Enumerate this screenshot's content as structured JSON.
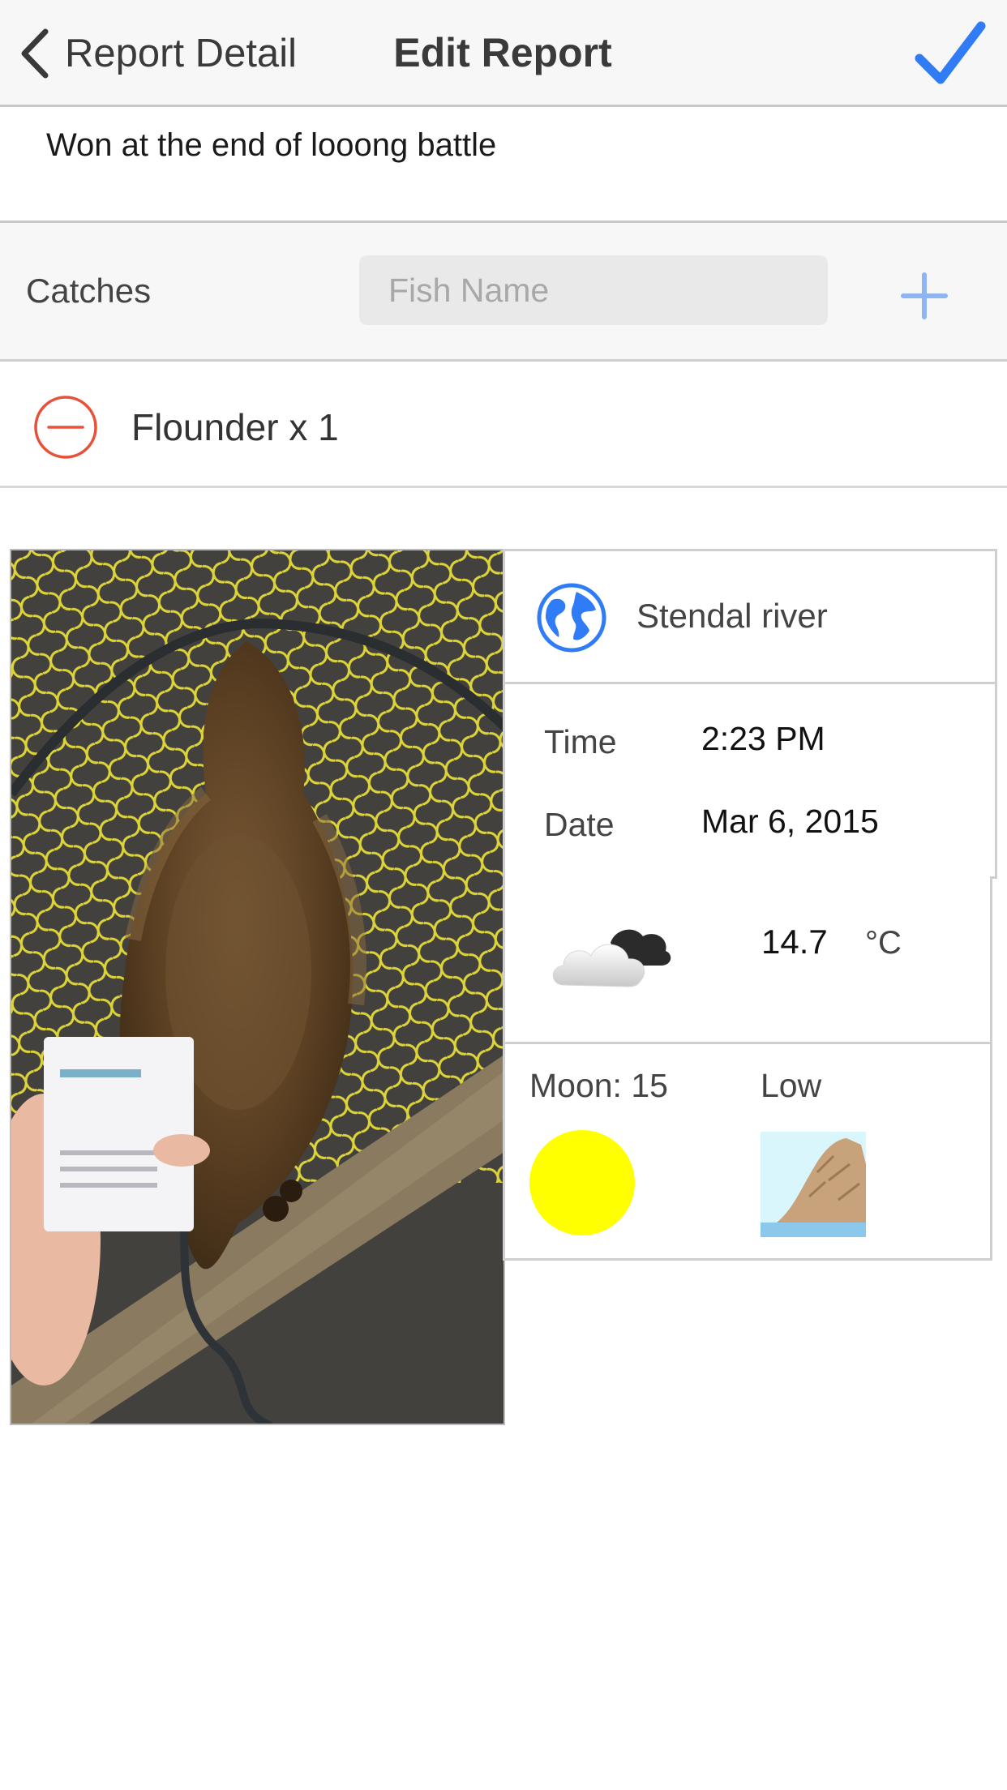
{
  "nav": {
    "back_label": "Report Detail",
    "title": "Edit Report",
    "accent": "#2f7cf6"
  },
  "description": {
    "text": "Won at the end of looong battle"
  },
  "catches": {
    "label": "Catches",
    "input_placeholder": "Fish Name",
    "input_value": "",
    "add_icon": "plus-icon",
    "items": [
      {
        "label": "Flounder x 1",
        "remove_icon": "minus-circle-icon",
        "remove_color": "#e8503a"
      }
    ]
  },
  "details": {
    "location": {
      "icon": "globe-icon",
      "text": "Stendal river"
    },
    "time_label": "Time",
    "time_value": "2:23 PM",
    "date_label": "Date",
    "date_value": "Mar 6, 2015",
    "weather": {
      "icon": "cloud-icon",
      "temperature": "14.7",
      "unit": "°C"
    },
    "moon": {
      "label": "Moon: 15",
      "icon": "full-moon-icon",
      "color": "#ffff00"
    },
    "tide": {
      "label": "Low",
      "icon": "low-tide-icon"
    }
  },
  "photo": {
    "subject": "flounder-photo"
  }
}
